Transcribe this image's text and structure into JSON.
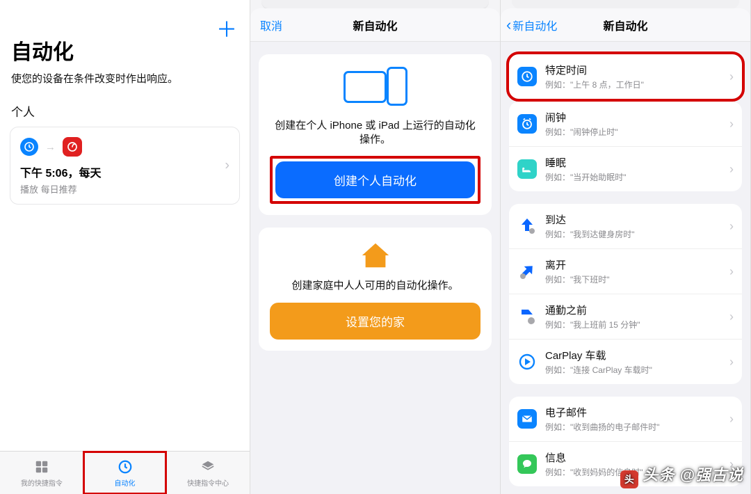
{
  "pane1": {
    "title": "自动化",
    "subtitle": "使您的设备在条件改变时作出响应。",
    "sectionLabel": "个人",
    "card": {
      "title": "下午 5:06，每天",
      "subtitle": "播放 每日推荐"
    },
    "tabs": [
      {
        "label": "我的快捷指令"
      },
      {
        "label": "自动化"
      },
      {
        "label": "快捷指令中心"
      }
    ]
  },
  "pane2": {
    "cancel": "取消",
    "title": "新自动化",
    "personal": {
      "desc": "创建在个人 iPhone 或 iPad 上运行的自动化操作。",
      "button": "创建个人自动化"
    },
    "home": {
      "desc": "创建家庭中人人可用的自动化操作。",
      "button": "设置您的家"
    }
  },
  "pane3": {
    "back": "新自动化",
    "title": "新自动化",
    "group1": [
      {
        "icon": "clock",
        "t1": "特定时间",
        "t2": "例如：\"上午 8 点，工作日\""
      }
    ],
    "group1b": [
      {
        "icon": "clock",
        "t1": "闹钟",
        "t2": "例如：\"闹钟停止时\""
      },
      {
        "icon": "bed",
        "t1": "睡眠",
        "t2": "例如：\"当开始助眠时\""
      }
    ],
    "group2": [
      {
        "icon": "arrive",
        "t1": "到达",
        "t2": "例如：\"我到达健身房时\""
      },
      {
        "icon": "leave",
        "t1": "离开",
        "t2": "例如：\"我下班时\""
      },
      {
        "icon": "commute",
        "t1": "通勤之前",
        "t2": "例如：\"我上班前 15 分钟\""
      },
      {
        "icon": "carplay",
        "t1": "CarPlay 车载",
        "t2": "例如：\"连接 CarPlay 车载时\""
      }
    ],
    "group3": [
      {
        "icon": "mail",
        "t1": "电子邮件",
        "t2": "例如：\"收到曲扬的电子邮件时\""
      },
      {
        "icon": "msg",
        "t1": "信息",
        "t2": "例如：\"收到妈妈的信息时\""
      }
    ]
  },
  "watermark": "头条 @强古说"
}
